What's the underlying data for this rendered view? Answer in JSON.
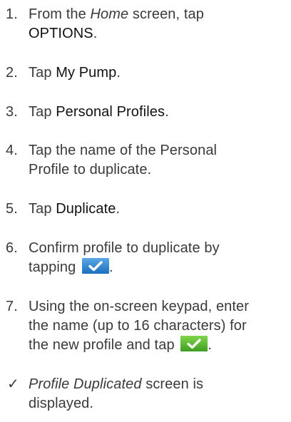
{
  "colors": {
    "text": "#3a3a3a",
    "keyword": "#111111",
    "blue_button_top": "#5aa7e6",
    "blue_button_bottom": "#1c6fc0",
    "green_button_top": "#7fd64b",
    "green_button_bottom": "#3f9e1f"
  },
  "steps": [
    {
      "number": "1.",
      "pre": "From the ",
      "italic": "Home",
      "mid": " screen, tap",
      "keyword": "OPTIONS",
      "post": "."
    },
    {
      "number": "2.",
      "pre": "Tap ",
      "keyword": "My Pump",
      "post": "."
    },
    {
      "number": "3.",
      "pre": "Tap ",
      "keyword": "Personal Profiles",
      "post": "."
    },
    {
      "number": "4.",
      "line1": "Tap the name of the Personal",
      "line2": "Profile to duplicate."
    },
    {
      "number": "5.",
      "pre": "Tap ",
      "keyword": "Duplicate",
      "post": "."
    },
    {
      "number": "6.",
      "line1": "Confirm profile to duplicate by",
      "line2": "tapping",
      "post": ".",
      "icon": "blue-checkmark-button-icon"
    },
    {
      "number": "7.",
      "line1": "Using the on-screen keypad, enter",
      "line2": "the name (up to 16 characters) for",
      "line3": "the new profile and tap",
      "post": ".",
      "icon": "green-checkmark-button-icon"
    }
  ],
  "result": {
    "marker": "✓",
    "italic": "Profile Duplicated",
    "line1_rest": " screen is",
    "line2": "displayed."
  }
}
